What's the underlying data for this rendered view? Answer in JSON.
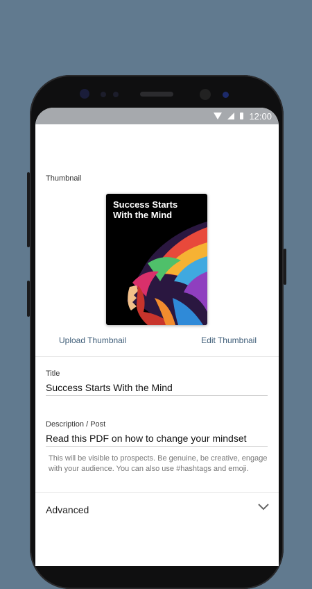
{
  "status_bar": {
    "time": "12:00"
  },
  "thumbnail": {
    "label": "Thumbnail",
    "cover_title": "Success Starts With the Mind",
    "upload_label": "Upload Thumbnail",
    "edit_label": "Edit Thumbnail"
  },
  "title_field": {
    "label": "Title",
    "value": "Success Starts With the Mind"
  },
  "description_field": {
    "label": "Description / Post",
    "value": "Read this PDF on how to change your mindset",
    "helper": "This will be visible to prospects. Be genuine, be creative, engage with your audience. You can also use #hashtags and emoji."
  },
  "advanced": {
    "label": "Advanced"
  },
  "colors": {
    "background": "#617a8f",
    "status_bar": "#a6a9ad",
    "link": "#3e5d78"
  }
}
